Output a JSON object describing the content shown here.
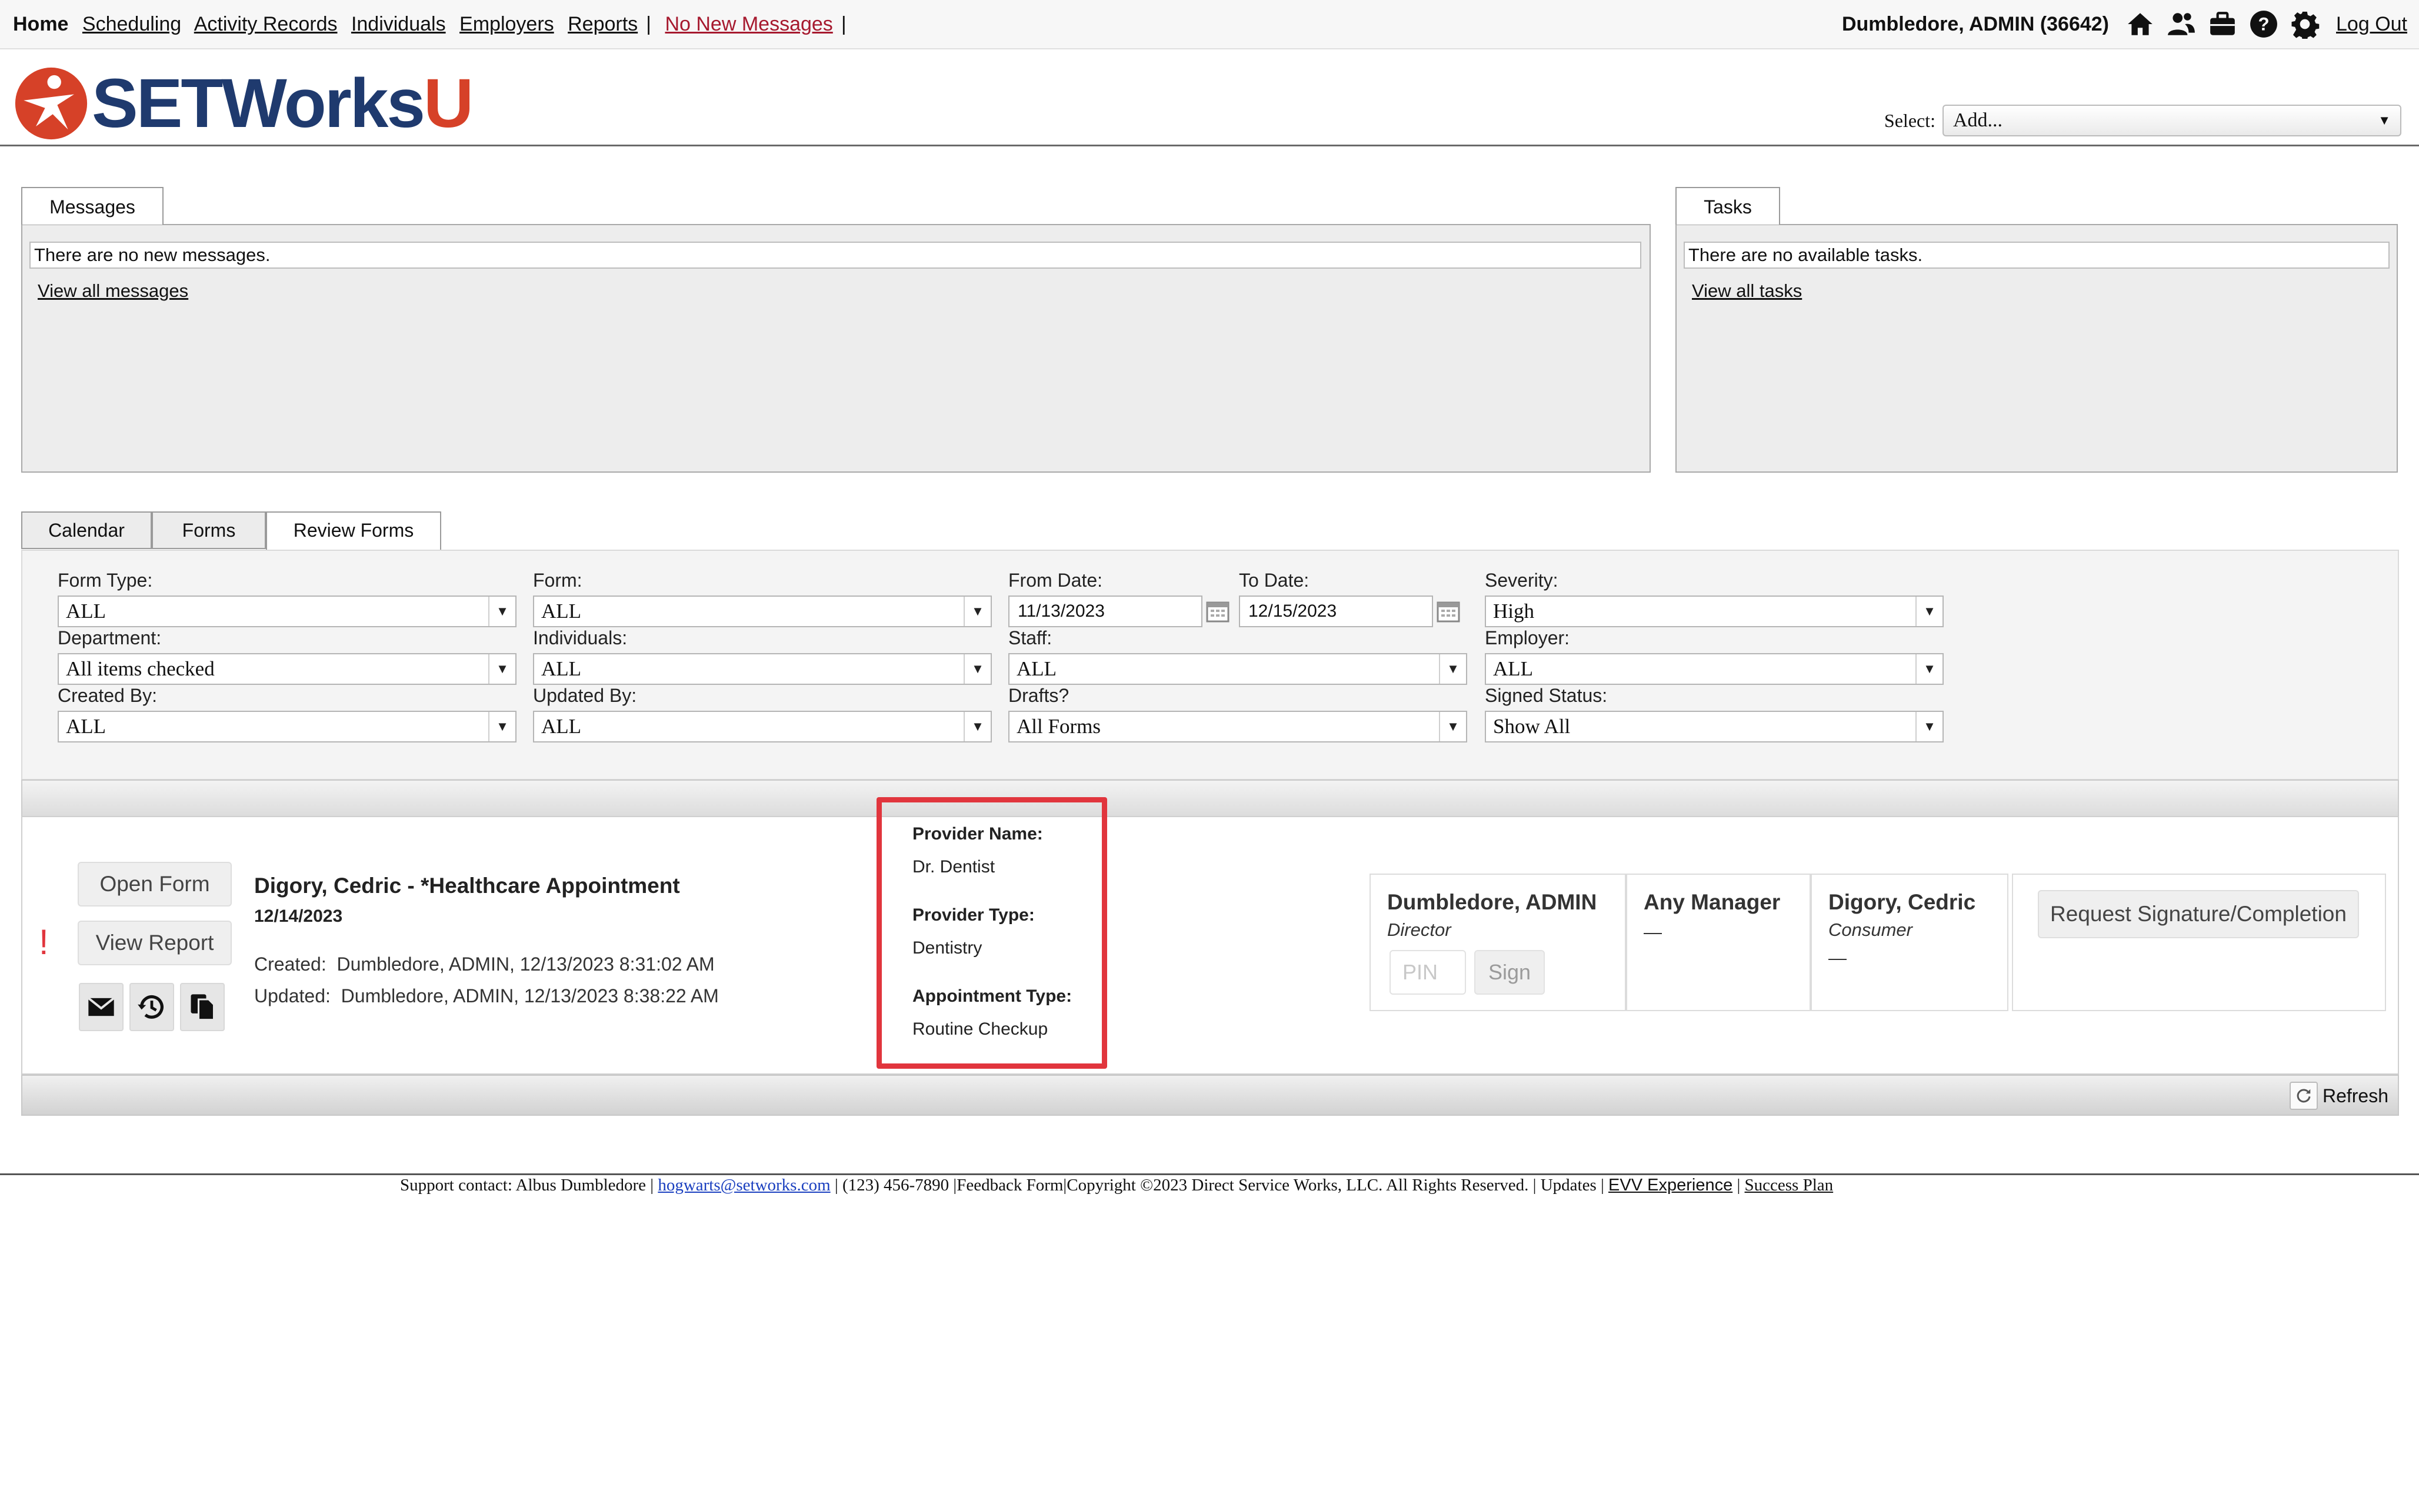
{
  "nav": {
    "home": "Home",
    "links": [
      "Scheduling",
      "Activity Records",
      "Individuals",
      "Employers",
      "Reports"
    ],
    "messages": "No New Messages",
    "user": "Dumbledore, ADMIN  (36642)",
    "logout": "Log Out",
    "icons": [
      "home-icon",
      "people-icon",
      "briefcase-icon",
      "help-icon",
      "gear-icon"
    ]
  },
  "header": {
    "brand_main": "SETWorks",
    "brand_suffix": "U",
    "select_label": "Select:",
    "select_value": "Add..."
  },
  "messages_panel": {
    "tab": "Messages",
    "notice": "There are no new messages.",
    "link": "View all messages"
  },
  "tasks_panel": {
    "tab": "Tasks",
    "notice": "There are no available tasks.",
    "link": "View all tasks"
  },
  "review_tabs": [
    "Calendar",
    "Forms",
    "Review Forms"
  ],
  "filters": {
    "form_type": {
      "label": "Form Type:",
      "value": "ALL"
    },
    "form": {
      "label": "Form:",
      "value": "ALL"
    },
    "from_date": {
      "label": "From Date:",
      "value": "11/13/2023"
    },
    "to_date": {
      "label": "To Date:",
      "value": "12/15/2023"
    },
    "severity": {
      "label": "Severity:",
      "value": "High"
    },
    "department": {
      "label": "Department:",
      "value": "All items checked"
    },
    "individuals": {
      "label": "Individuals:",
      "value": "ALL"
    },
    "staff": {
      "label": "Staff:",
      "value": "ALL"
    },
    "employer": {
      "label": "Employer:",
      "value": "ALL"
    },
    "created_by": {
      "label": "Created By:",
      "value": "ALL"
    },
    "updated_by": {
      "label": "Updated By:",
      "value": "ALL"
    },
    "drafts": {
      "label": "Drafts?",
      "value": "All Forms"
    },
    "signed_status": {
      "label": "Signed Status:",
      "value": "Show All"
    }
  },
  "result": {
    "flag": "!",
    "open_form": "Open Form",
    "view_report": "View Report",
    "title": "Digory, Cedric - *Healthcare Appointment",
    "date": "12/14/2023",
    "created_label": "Created:",
    "created_value": "Dumbledore, ADMIN, 12/13/2023 8:31:02 AM",
    "updated_label": "Updated:",
    "updated_value": "Dumbledore, ADMIN, 12/13/2023 8:38:22 AM",
    "details": [
      {
        "label": "Provider Name:",
        "value": "Dr. Dentist"
      },
      {
        "label": "Provider Type:",
        "value": "Dentistry"
      },
      {
        "label": "Appointment Type:",
        "value": "Routine Checkup"
      }
    ],
    "signers": [
      {
        "name": "Dumbledore, ADMIN",
        "role": "Director",
        "pin": "PIN",
        "sign": "Sign"
      },
      {
        "name": "Any Manager",
        "role": "",
        "status": "—"
      },
      {
        "name": "Digory, Cedric",
        "role": "Consumer",
        "status": "—"
      }
    ],
    "request_button": "Request Signature/Completion",
    "refresh": "Refresh",
    "highlight_color": "#e1353d"
  },
  "footer": {
    "support": "Support contact: Albus Dumbledore |",
    "email": "hogwarts@setworks.com",
    "phone": "| (123) 456-7890 |Feedback Form|Copyright ©2023 Direct Service Works, LLC. All Rights Reserved.  |  Updates  |",
    "evv": "EVV Experience",
    "pipe": "|",
    "success": "Success Plan"
  }
}
